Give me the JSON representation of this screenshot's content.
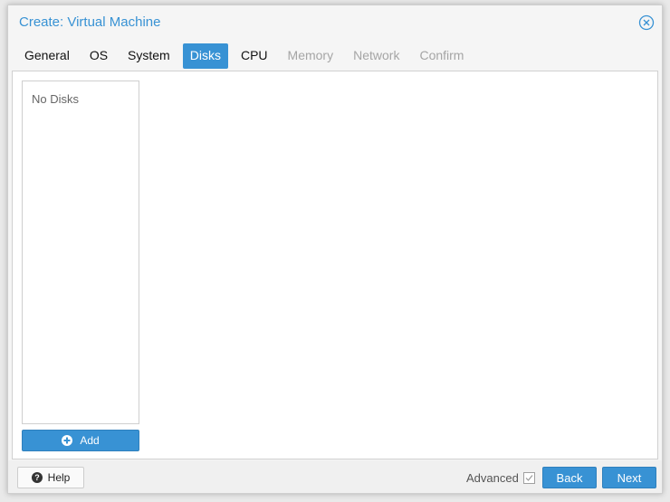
{
  "dialog": {
    "title": "Create: Virtual Machine",
    "close_icon": "close-circle-icon"
  },
  "tabs": [
    {
      "label": "General",
      "state": "enabled"
    },
    {
      "label": "OS",
      "state": "enabled"
    },
    {
      "label": "System",
      "state": "enabled"
    },
    {
      "label": "Disks",
      "state": "active"
    },
    {
      "label": "CPU",
      "state": "enabled"
    },
    {
      "label": "Memory",
      "state": "disabled"
    },
    {
      "label": "Network",
      "state": "disabled"
    },
    {
      "label": "Confirm",
      "state": "disabled"
    }
  ],
  "disks": {
    "empty_text": "No Disks",
    "add_label": "Add",
    "add_icon": "plus-circle-icon"
  },
  "footer": {
    "help_label": "Help",
    "help_icon": "question-circle-icon",
    "advanced_label": "Advanced",
    "advanced_checked": false,
    "back_label": "Back",
    "next_label": "Next"
  },
  "colors": {
    "accent": "#3892d4",
    "disabled_text": "#a5a5a5"
  }
}
